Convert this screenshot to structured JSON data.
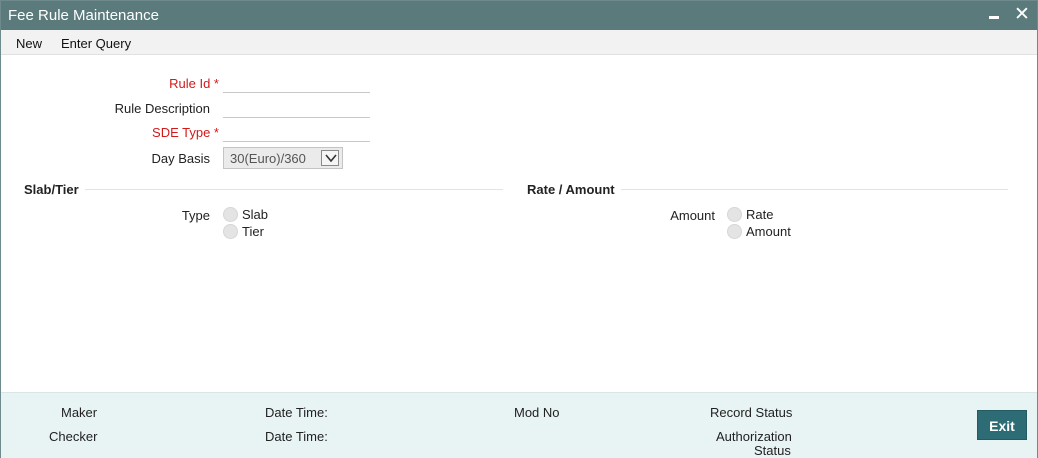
{
  "window": {
    "title": "Fee Rule Maintenance",
    "minimize_glyph": "minimize-icon",
    "close_glyph": "✕"
  },
  "menu": {
    "new_label": "New",
    "enter_query_label": "Enter Query"
  },
  "form": {
    "rule_id_label": "Rule Id *",
    "rule_id_value": "",
    "rule_description_label": "Rule Description",
    "rule_description_value": "",
    "sde_type_label": "SDE Type *",
    "sde_type_value": "",
    "day_basis_label": "Day Basis",
    "day_basis_value": "30(Euro)/360"
  },
  "slab_tier": {
    "section_title": "Slab/Tier",
    "type_label": "Type",
    "options": [
      "Slab",
      "Tier"
    ]
  },
  "rate_amount": {
    "section_title": "Rate / Amount",
    "amount_label": "Amount",
    "options": [
      "Rate",
      "Amount"
    ]
  },
  "footer": {
    "maker_label": "Maker",
    "checker_label": "Checker",
    "date_time_label_1": "Date Time:",
    "date_time_label_2": "Date Time:",
    "mod_no_label": "Mod No",
    "record_status_label": "Record Status",
    "authorization_label": "Authorization",
    "status_label": "Status",
    "exit_label": "Exit"
  },
  "colors": {
    "titlebar": "#5a7a7c",
    "required": "#d11a1a",
    "footer_bg": "#e8f3f4",
    "exit_button": "#2d6c74"
  }
}
